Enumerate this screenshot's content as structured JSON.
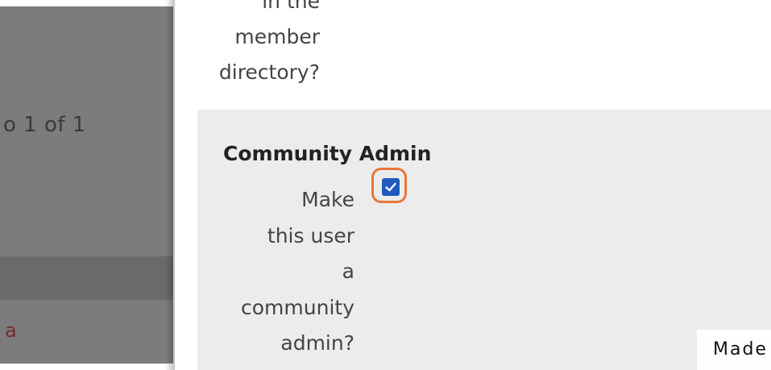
{
  "background_page": {
    "pagination_text": "o 1 of 1",
    "link_text": "a"
  },
  "directory_question": {
    "clipped_line": "in the",
    "line1": "member",
    "line2": "directory?"
  },
  "community_admin": {
    "title": "Community Admin",
    "description_lines": [
      "Make",
      "this user",
      "a",
      "community",
      "admin?"
    ],
    "checked": true
  },
  "colors": {
    "highlight": "#e8763a",
    "checkbox": "#1f5bbf"
  },
  "watermark": {
    "text": "Made with Tango.us"
  }
}
